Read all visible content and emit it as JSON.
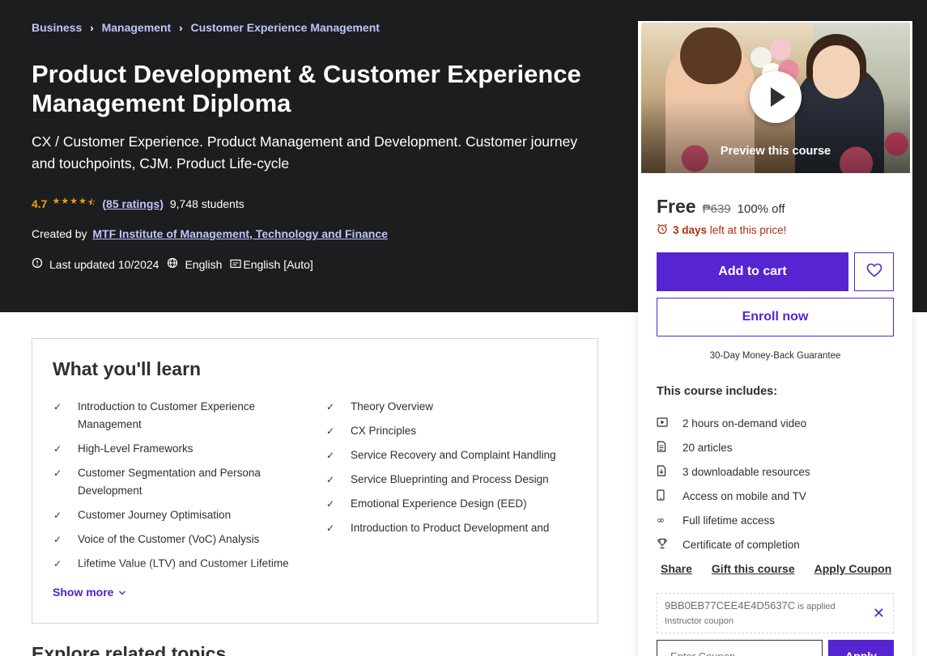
{
  "colors": {
    "hero_bg": "#1c1d1f",
    "accent_purple": "#5624d0",
    "link_lavender": "#c0c4fc",
    "star_orange": "#f69c08",
    "urgency_red": "#b32d0f"
  },
  "breadcrumb": [
    "Business",
    "Management",
    "Customer Experience Management"
  ],
  "course": {
    "title": "Product Development & Customer Experience Management Diploma",
    "subtitle": "CX / Customer Experience. Product Management and Development. Customer journey and touchpoints, CJM. Product Life-cycle",
    "rating": "4.7",
    "stars": 4.5,
    "ratings_count": "(85 ratings)",
    "students": "9,748 students",
    "created_by_label": "Created by",
    "instructor": "MTF Institute of Management, Technology and Finance",
    "last_updated": "Last updated 10/2024",
    "language": "English",
    "captions": "English [Auto]"
  },
  "learn": {
    "title": "What you'll learn",
    "left": [
      "Introduction to Customer Experience Management",
      "High-Level Frameworks",
      "Customer Segmentation and Persona Development",
      "Customer Journey Optimisation",
      "Voice of the Customer (VoC) Analysis",
      "Lifetime Value (LTV) and Customer Lifetime"
    ],
    "right": [
      "Theory Overview",
      "CX Principles",
      "Service Recovery and Complaint Handling",
      "Service Blueprinting and Process Design",
      "Emotional Experience Design (EED)",
      "Introduction to Product Development and"
    ],
    "show_more": "Show more"
  },
  "below_heading": "Explore related topics",
  "sidebar": {
    "preview_label": "Preview this course",
    "price": "Free",
    "original_price": "₱639",
    "discount": "100% off",
    "timer_bold": "3 days",
    "timer_rest": "left at this price!",
    "add_to_cart": "Add to cart",
    "wishlist_icon": "heart-icon",
    "enroll": "Enroll now",
    "guarantee": "30-Day Money-Back Guarantee",
    "includes_title": "This course includes:",
    "includes": [
      {
        "icon": "video-icon",
        "label": "2 hours on-demand video"
      },
      {
        "icon": "article-icon",
        "label": "20 articles"
      },
      {
        "icon": "download-icon",
        "label": "3 downloadable resources"
      },
      {
        "icon": "mobile-icon",
        "label": "Access on mobile and TV"
      },
      {
        "icon": "infinity-icon",
        "label": "Full lifetime access"
      },
      {
        "icon": "trophy-icon",
        "label": "Certificate of completion"
      }
    ],
    "links": [
      "Share",
      "Gift this course",
      "Apply Coupon"
    ],
    "coupon_code": "9BB0EB77CEE4E4D5637C",
    "coupon_applied": "is applied",
    "coupon_type": "Instructor coupon",
    "coupon_placeholder": "Enter Coupon",
    "apply": "Apply"
  }
}
